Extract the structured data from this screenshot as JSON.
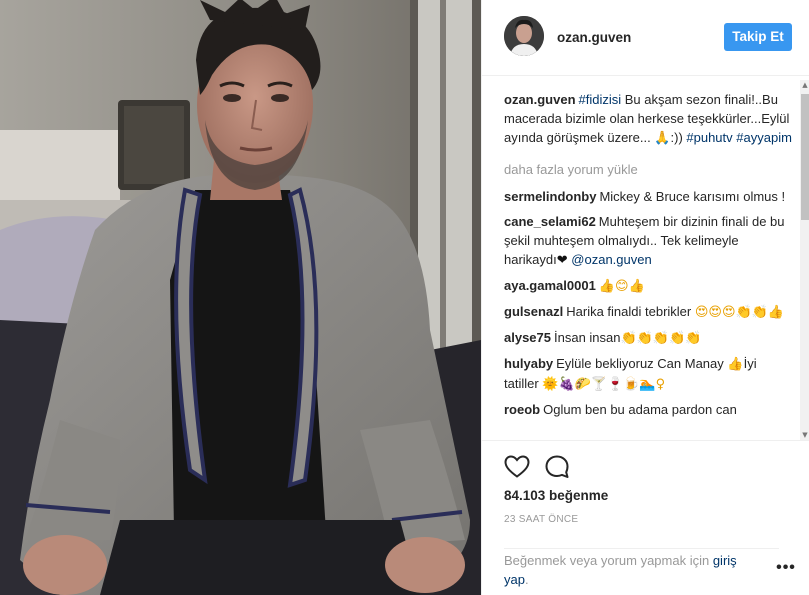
{
  "post": {
    "username": "ozan.guven",
    "follow_label": "Takip Et",
    "photo_alt": "photo",
    "load_more": "daha fazla yorum yükle",
    "likes": "84.103 beğenme",
    "time": "23 SAAT ÖNCE",
    "login_text": "Beğenmek veya yorum yapmak için",
    "login_link": "giriş yap",
    "login_end": ".",
    "more_label": "•••"
  },
  "caption": {
    "user": "ozan.guven",
    "tag1": "#fidizisi",
    "text": " Bu akşam sezon finali!..Bu macerada bizimle olan herkese teşekkürler...Eylül ayında görüşmek üzere... ",
    "emoji": "🙏",
    "text2": ":)) ",
    "tag2": "#puhutv",
    "tag3": "#ayyapim"
  },
  "comments": [
    {
      "user": "sermelindonby",
      "text": "Mickey & Bruce karısımı olmus !",
      "emoji": ""
    },
    {
      "user": "cane_selami62",
      "text": "Muhteşem bir dizinin finali de bu şekil muhteşem olmalıydı.. Tek kelimeyle harikaydı",
      "emoji": "❤",
      "mention": "@ozan.guven"
    },
    {
      "user": "aya.gamal0001",
      "text": "",
      "emoji": "👍😊👍"
    },
    {
      "user": "gulsenazl",
      "text": "Harika finaldi tebrikler",
      "emoji": "😍😍😍👏👏👍"
    },
    {
      "user": "alyse75",
      "text": "İnsan insan",
      "emoji": "👏👏👏👏👏"
    },
    {
      "user": "hulyaby",
      "text": "Eylüle bekliyoruz Can Manay",
      "emoji": "👍",
      "text2": "İyi tatiller",
      "emoji2": "🌞🍇🌮🍸🍷🍺🏊♀"
    },
    {
      "user": "roeob",
      "text": "Oglum ben bu adama pardon can",
      "emoji": ""
    }
  ],
  "icons": {
    "heart": "heart-icon",
    "comment": "comment-icon",
    "scroll_up": "▲",
    "scroll_down": "▼"
  },
  "colors": {
    "accent": "#3897f0",
    "link": "#003569",
    "muted": "#999999"
  }
}
